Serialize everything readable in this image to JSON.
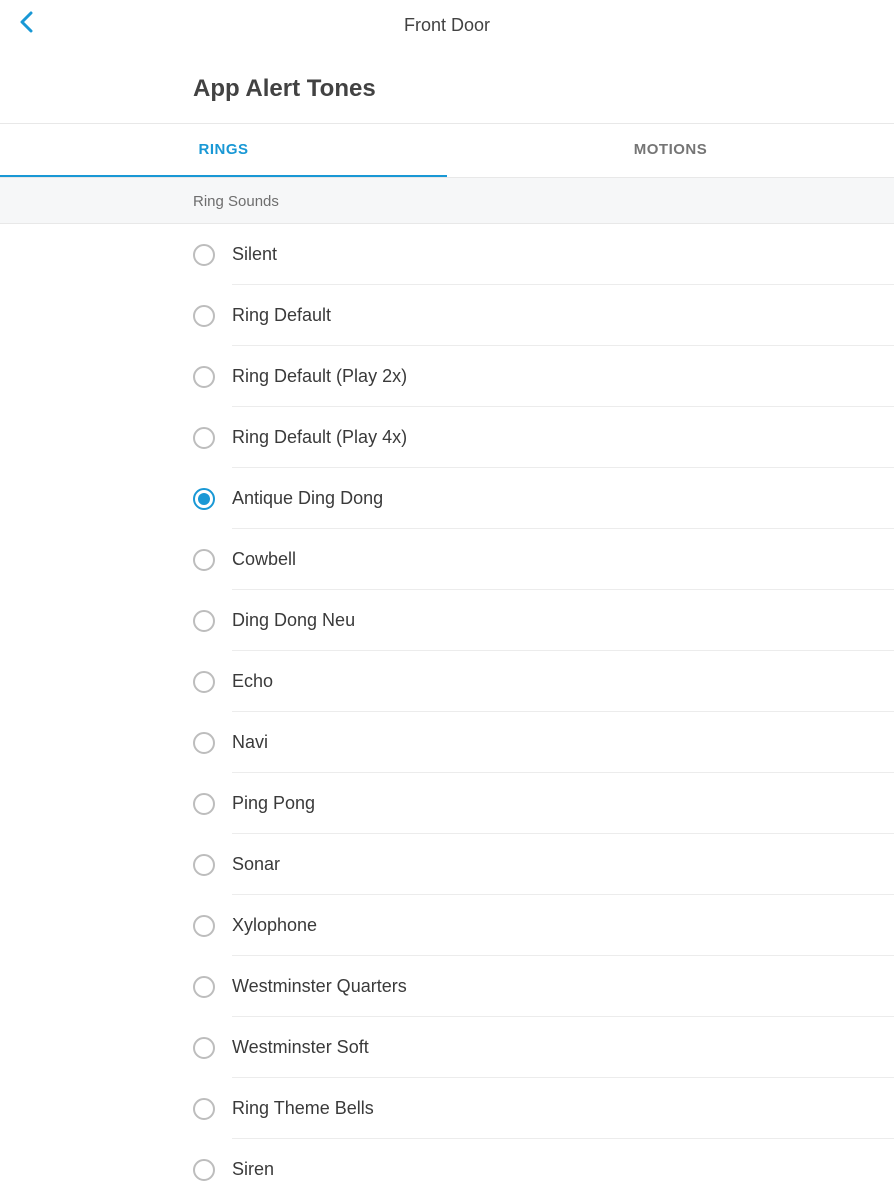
{
  "header": {
    "title": "Front Door"
  },
  "page": {
    "title": "App Alert Tones"
  },
  "tabs": [
    {
      "label": "RINGS",
      "active": true
    },
    {
      "label": "MOTIONS",
      "active": false
    }
  ],
  "section": {
    "title": "Ring Sounds"
  },
  "sounds": [
    {
      "label": "Silent",
      "selected": false
    },
    {
      "label": "Ring Default",
      "selected": false
    },
    {
      "label": "Ring Default (Play 2x)",
      "selected": false
    },
    {
      "label": "Ring Default (Play 4x)",
      "selected": false
    },
    {
      "label": "Antique Ding Dong",
      "selected": true
    },
    {
      "label": "Cowbell",
      "selected": false
    },
    {
      "label": "Ding Dong Neu",
      "selected": false
    },
    {
      "label": "Echo",
      "selected": false
    },
    {
      "label": "Navi",
      "selected": false
    },
    {
      "label": "Ping Pong",
      "selected": false
    },
    {
      "label": "Sonar",
      "selected": false
    },
    {
      "label": "Xylophone",
      "selected": false
    },
    {
      "label": "Westminster Quarters",
      "selected": false
    },
    {
      "label": "Westminster Soft",
      "selected": false
    },
    {
      "label": "Ring Theme Bells",
      "selected": false
    },
    {
      "label": "Siren",
      "selected": false
    }
  ]
}
